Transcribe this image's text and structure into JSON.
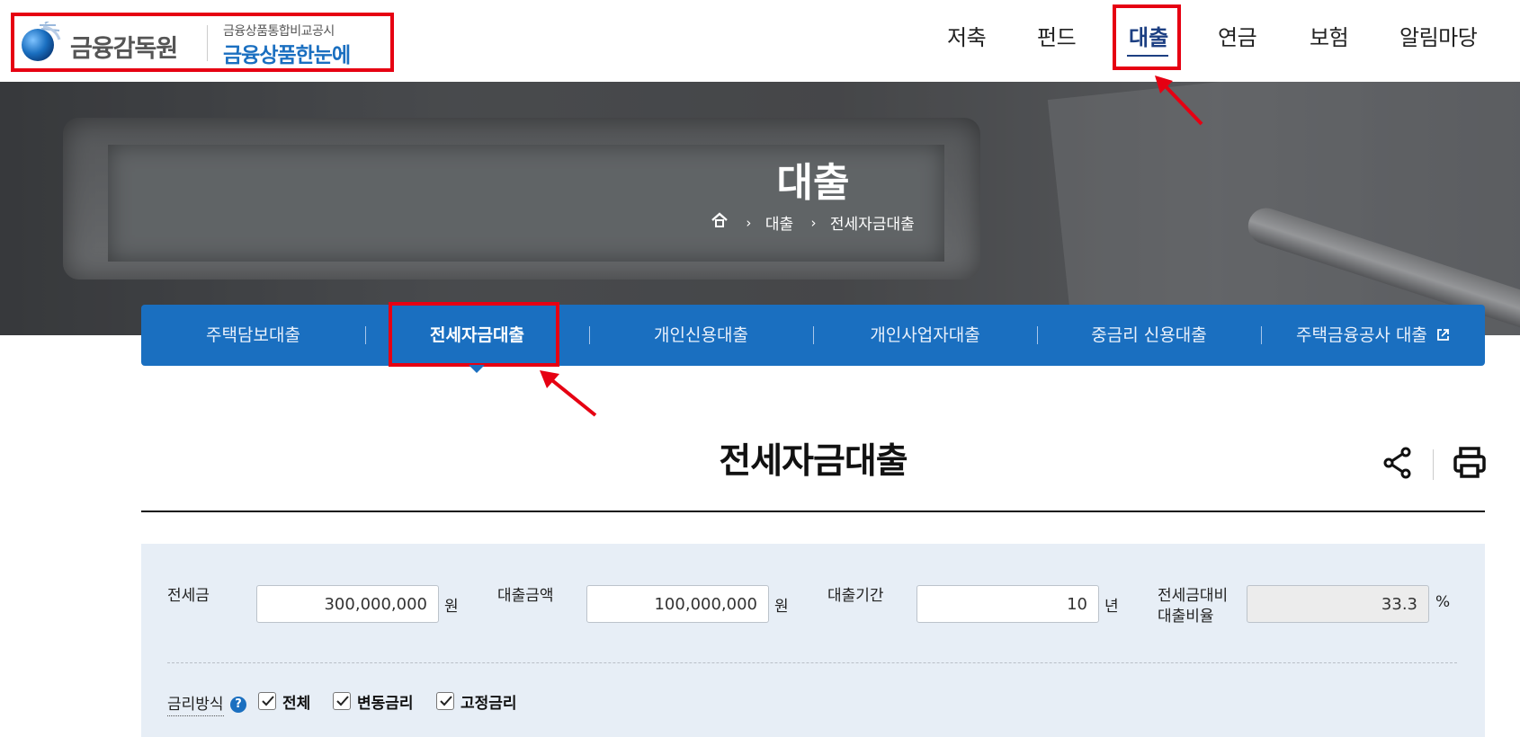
{
  "header": {
    "logo": {
      "org_name": "금융감독원",
      "sub_text": "금융상품통합비교공시",
      "main_text": "금융상품한눈에"
    },
    "nav": [
      {
        "label": "저축"
      },
      {
        "label": "펀드"
      },
      {
        "label": "대출",
        "active": true
      },
      {
        "label": "연금"
      },
      {
        "label": "보험"
      },
      {
        "label": "알림마당"
      }
    ]
  },
  "hero": {
    "title": "대출",
    "breadcrumb": [
      "대출",
      "전세자금대출"
    ],
    "sep": "›"
  },
  "tabs": [
    {
      "label": "주택담보대출"
    },
    {
      "label": "전세자금대출",
      "active": true
    },
    {
      "label": "개인신용대출"
    },
    {
      "label": "개인사업자대출"
    },
    {
      "label": "중금리 신용대출"
    },
    {
      "label": "주택금융공사 대출",
      "external": true
    }
  ],
  "page": {
    "title": "전세자금대출",
    "tools": [
      "share-icon",
      "print-icon"
    ]
  },
  "form": {
    "deposit": {
      "label": "전세금",
      "value": "300,000,000",
      "unit": "원"
    },
    "loan_amount": {
      "label": "대출금액",
      "value": "100,000,000",
      "unit": "원"
    },
    "loan_period": {
      "label": "대출기간",
      "value": "10",
      "unit": "년"
    },
    "ratio": {
      "label_line1": "전세금대비",
      "label_line2": "대출비율",
      "value": "33.3",
      "unit": "%"
    },
    "rate_type": {
      "label": "금리방식",
      "help": "?",
      "options": [
        {
          "label": "전체",
          "checked": true
        },
        {
          "label": "변동금리",
          "checked": true
        },
        {
          "label": "고정금리",
          "checked": true
        }
      ]
    }
  },
  "colors": {
    "brand_blue": "#1a6fc0",
    "nav_active": "#1c3f82",
    "annotation_red": "#e60012",
    "panel_bg": "#e7eef6"
  }
}
